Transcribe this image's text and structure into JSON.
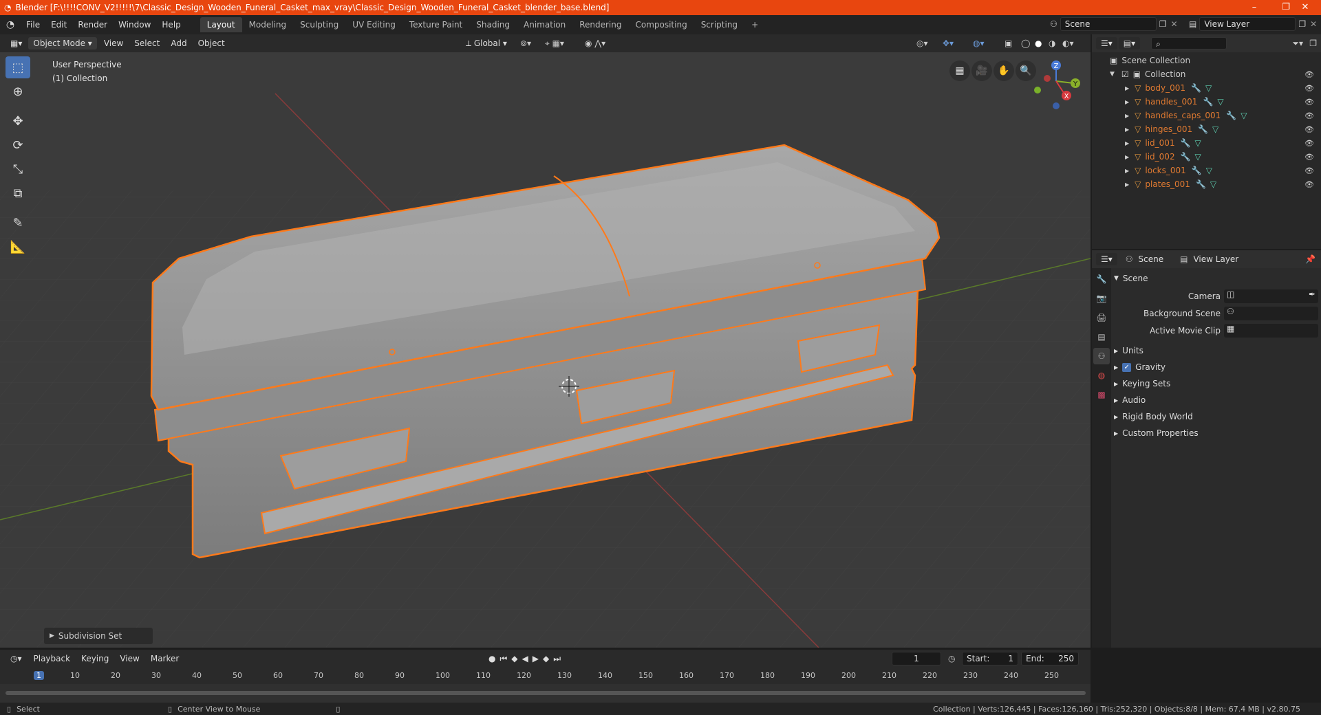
{
  "window": {
    "title": "Blender [F:\\!!!!CONV_V2!!!!!\\7\\Classic_Design_Wooden_Funeral_Casket_max_vray\\Classic_Design_Wooden_Funeral_Casket_blender_base.blend]",
    "minimize": "–",
    "maximize": "❐",
    "close": "✕"
  },
  "menu": [
    "File",
    "Edit",
    "Render",
    "Window",
    "Help"
  ],
  "workspaces": [
    "Layout",
    "Modeling",
    "Sculpting",
    "UV Editing",
    "Texture Paint",
    "Shading",
    "Animation",
    "Rendering",
    "Compositing",
    "Scripting"
  ],
  "active_workspace": "Layout",
  "add_workspace": "+",
  "scene_field": "Scene",
  "view_layer_field": "View Layer",
  "viewport_header": {
    "mode": "Object Mode",
    "menus": [
      "View",
      "Select",
      "Add",
      "Object"
    ],
    "transform": "Global"
  },
  "viewport": {
    "perspective": "User Perspective",
    "collection": "(1) Collection"
  },
  "gizmo": {
    "z": "Z",
    "y": "Y",
    "x": "X"
  },
  "last_operator": "Subdivision Set",
  "outliner": {
    "scene_collection": "Scene Collection",
    "collection": "Collection",
    "objects": [
      "body_001",
      "handles_001",
      "handles_caps_001",
      "hinges_001",
      "lid_001",
      "lid_002",
      "locks_001",
      "plates_001"
    ]
  },
  "properties": {
    "tab_scene": "Scene",
    "tab_view_layer": "View Layer",
    "section_scene": "Scene",
    "camera_label": "Camera",
    "background_scene_label": "Background Scene",
    "active_movie_clip_label": "Active Movie Clip",
    "sections": [
      "Units",
      "Gravity",
      "Keying Sets",
      "Audio",
      "Rigid Body World",
      "Custom Properties"
    ],
    "gravity_checked": true
  },
  "timeline": {
    "menus": [
      "Playback",
      "Keying",
      "View",
      "Marker"
    ],
    "current_frame": "1",
    "start_label": "Start:",
    "start": "1",
    "end_label": "End:",
    "end": "250",
    "ticks": [
      "1",
      "10",
      "20",
      "30",
      "40",
      "50",
      "60",
      "70",
      "80",
      "90",
      "100",
      "110",
      "120",
      "130",
      "140",
      "150",
      "160",
      "170",
      "180",
      "190",
      "200",
      "210",
      "220",
      "230",
      "240",
      "250"
    ]
  },
  "status": {
    "left": "Select",
    "middle": "Center View to Mouse",
    "right": "Collection | Verts:126,445 | Faces:126,160 | Tris:252,320 | Objects:8/8 | Mem: 67.4 MB | v2.80.75"
  },
  "colors": {
    "title_bar": "#e8460f",
    "selected_outline": "#ff7a1a",
    "active_blue": "#4772b3",
    "object_orange": "#e07a31"
  }
}
